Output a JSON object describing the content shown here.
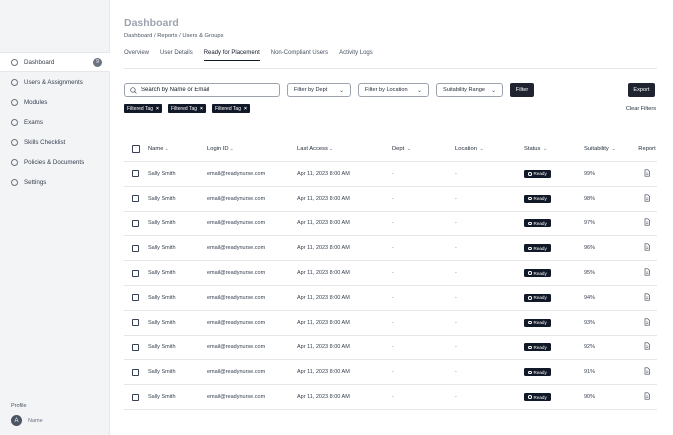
{
  "sidebar": {
    "items": [
      {
        "label": "Dashboard",
        "badge": "9",
        "icon": "circle-outline-icon",
        "active": true
      },
      {
        "label": "Users & Assignments",
        "icon": "circle-outline-icon"
      },
      {
        "label": "Modules",
        "icon": "circle-outline-icon"
      },
      {
        "label": "Exams",
        "icon": "circle-outline-icon"
      },
      {
        "label": "Skills Checklist",
        "icon": "circle-outline-icon"
      },
      {
        "label": "Policies & Documents",
        "icon": "circle-outline-icon"
      },
      {
        "label": "Settings",
        "icon": "circle-outline-icon"
      }
    ],
    "profile_label": "Profile",
    "avatar_initial": "A",
    "profile_name": "Name"
  },
  "header": {
    "title": "Dashboard",
    "breadcrumb": "Dashboard / Reports / Users & Groups"
  },
  "tabs": [
    {
      "label": "Overview"
    },
    {
      "label": "User Details"
    },
    {
      "label": "Ready for Placement",
      "active": true
    },
    {
      "label": "Non-Compliant Users"
    },
    {
      "label": "Activity Logs"
    }
  ],
  "toolbar": {
    "search_placeholder": "Search by Name or Email",
    "filter_dept": "Filter by Dept",
    "filter_location": "Filter by Location",
    "suitability_range": "Suitability Range",
    "filter_button": "Filter",
    "export_button": "Export",
    "clear_filters": "Clear Filters",
    "tags": [
      "Filtered Tag",
      "Filtered Tag",
      "Filtered Tag"
    ],
    "tag_remove": "×"
  },
  "table": {
    "columns": {
      "name": "Name",
      "login": "Login ID",
      "last_access": "Last Access",
      "dept": "Dept",
      "location": "Location",
      "status": "Status",
      "suitability": "Suitability",
      "report": "Report"
    },
    "rows": [
      {
        "name": "Sally Smith",
        "login": "email@readynurse.com",
        "last_access": "Apr 11, 2023 8:00 AM",
        "dept": "-",
        "location": "-",
        "status": "Ready",
        "suitability": "99%"
      },
      {
        "name": "Sally Smith",
        "login": "email@readynurse.com",
        "last_access": "Apr 11, 2023 8:00 AM",
        "dept": "-",
        "location": "-",
        "status": "Ready",
        "suitability": "98%"
      },
      {
        "name": "Sally Smith",
        "login": "email@readynurse.com",
        "last_access": "Apr 11, 2023 8:00 AM",
        "dept": "-",
        "location": "-",
        "status": "Ready",
        "suitability": "97%"
      },
      {
        "name": "Sally Smith",
        "login": "email@readynurse.com",
        "last_access": "Apr 11, 2023 8:00 AM",
        "dept": "-",
        "location": "-",
        "status": "Ready",
        "suitability": "96%"
      },
      {
        "name": "Sally Smith",
        "login": "email@readynurse.com",
        "last_access": "Apr 11, 2023 8:00 AM",
        "dept": "-",
        "location": "-",
        "status": "Ready",
        "suitability": "95%"
      },
      {
        "name": "Sally Smith",
        "login": "email@readynurse.com",
        "last_access": "Apr 11, 2023 8:00 AM",
        "dept": "-",
        "location": "-",
        "status": "Ready",
        "suitability": "94%"
      },
      {
        "name": "Sally Smith",
        "login": "email@readynurse.com",
        "last_access": "Apr 11, 2023 8:00 AM",
        "dept": "-",
        "location": "-",
        "status": "Ready",
        "suitability": "93%"
      },
      {
        "name": "Sally Smith",
        "login": "email@readynurse.com",
        "last_access": "Apr 11, 2023 8:00 AM",
        "dept": "-",
        "location": "-",
        "status": "Ready",
        "suitability": "92%"
      },
      {
        "name": "Sally Smith",
        "login": "email@readynurse.com",
        "last_access": "Apr 11, 2023 8:00 AM",
        "dept": "-",
        "location": "-",
        "status": "Ready",
        "suitability": "91%"
      },
      {
        "name": "Sally Smith",
        "login": "email@readynurse.com",
        "last_access": "Apr 11, 2023 8:00 AM",
        "dept": "-",
        "location": "-",
        "status": "Ready",
        "suitability": "90%"
      }
    ]
  },
  "colors": {
    "accent_dark": "#1f2430",
    "sidebar_bg": "#f3f4f6",
    "border": "#e5e7eb"
  }
}
